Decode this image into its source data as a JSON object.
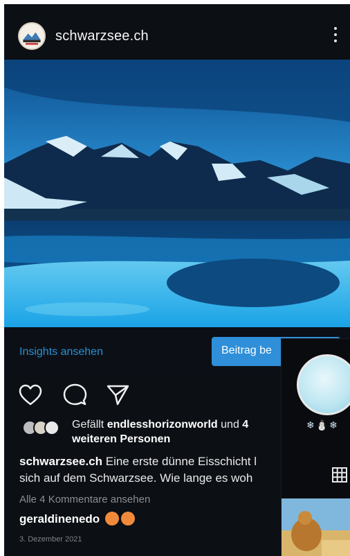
{
  "header": {
    "username": "schwarzsee.ch",
    "menu_icon": "more-vertical-icon"
  },
  "post": {
    "image_description_icon": "photo",
    "insights_label": "Insights ansehen",
    "promote_label": "Beitrag be"
  },
  "actions": {
    "like_icon": "heart-icon",
    "comment_icon": "comment-icon",
    "share_icon": "send-icon"
  },
  "likes": {
    "prefix": "Gefällt ",
    "user": "endlesshorizonworld",
    "middle": " und ",
    "count": "4",
    "suffix": "weiteren Personen"
  },
  "caption": {
    "user": "schwarzsee.ch",
    "line1": " Eine erste dünne Eisschicht l",
    "line2": "sich auf dem Schwarzsee. Wie lange es woh"
  },
  "comments": {
    "view_all": "Alle 4 Kommentare ansehen",
    "commenter": "geraldinenedo"
  },
  "date": "3. Dezember 2021",
  "side_panel": {
    "icons_text": "❄⛄❄",
    "grid_icon": "grid-icon"
  },
  "colors": {
    "background": "#0c0f14",
    "accent": "#2f8fd8",
    "link": "#2a8fd4"
  }
}
